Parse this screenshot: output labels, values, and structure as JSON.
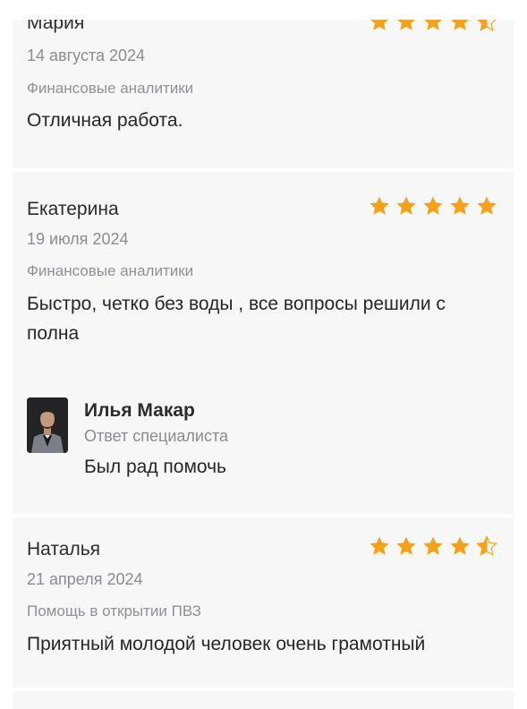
{
  "reviews": [
    {
      "author": "Мария",
      "date": "14 августа 2024",
      "category": "Финансовые аналитики",
      "text": "Отличная работа.",
      "rating": 4.5
    },
    {
      "author": "Екатерина",
      "date": "19 июля 2024",
      "category": "Финансовые аналитики",
      "text": "Быстро, четко без воды , все вопросы решили с полна",
      "rating": 5,
      "reply": {
        "name": "Илья Макар",
        "role": "Ответ специалиста",
        "text": "Был рад помочь"
      }
    },
    {
      "author": "Наталья",
      "date": "21 апреля 2024",
      "category": "Помощь в открытии ПВЗ",
      "text": "Приятный молодой человек очень грамотный",
      "rating": 4.5
    }
  ],
  "colors": {
    "star": "#f5a21a",
    "card_bg": "#f7f7f8",
    "muted_text": "#8b8b94"
  }
}
